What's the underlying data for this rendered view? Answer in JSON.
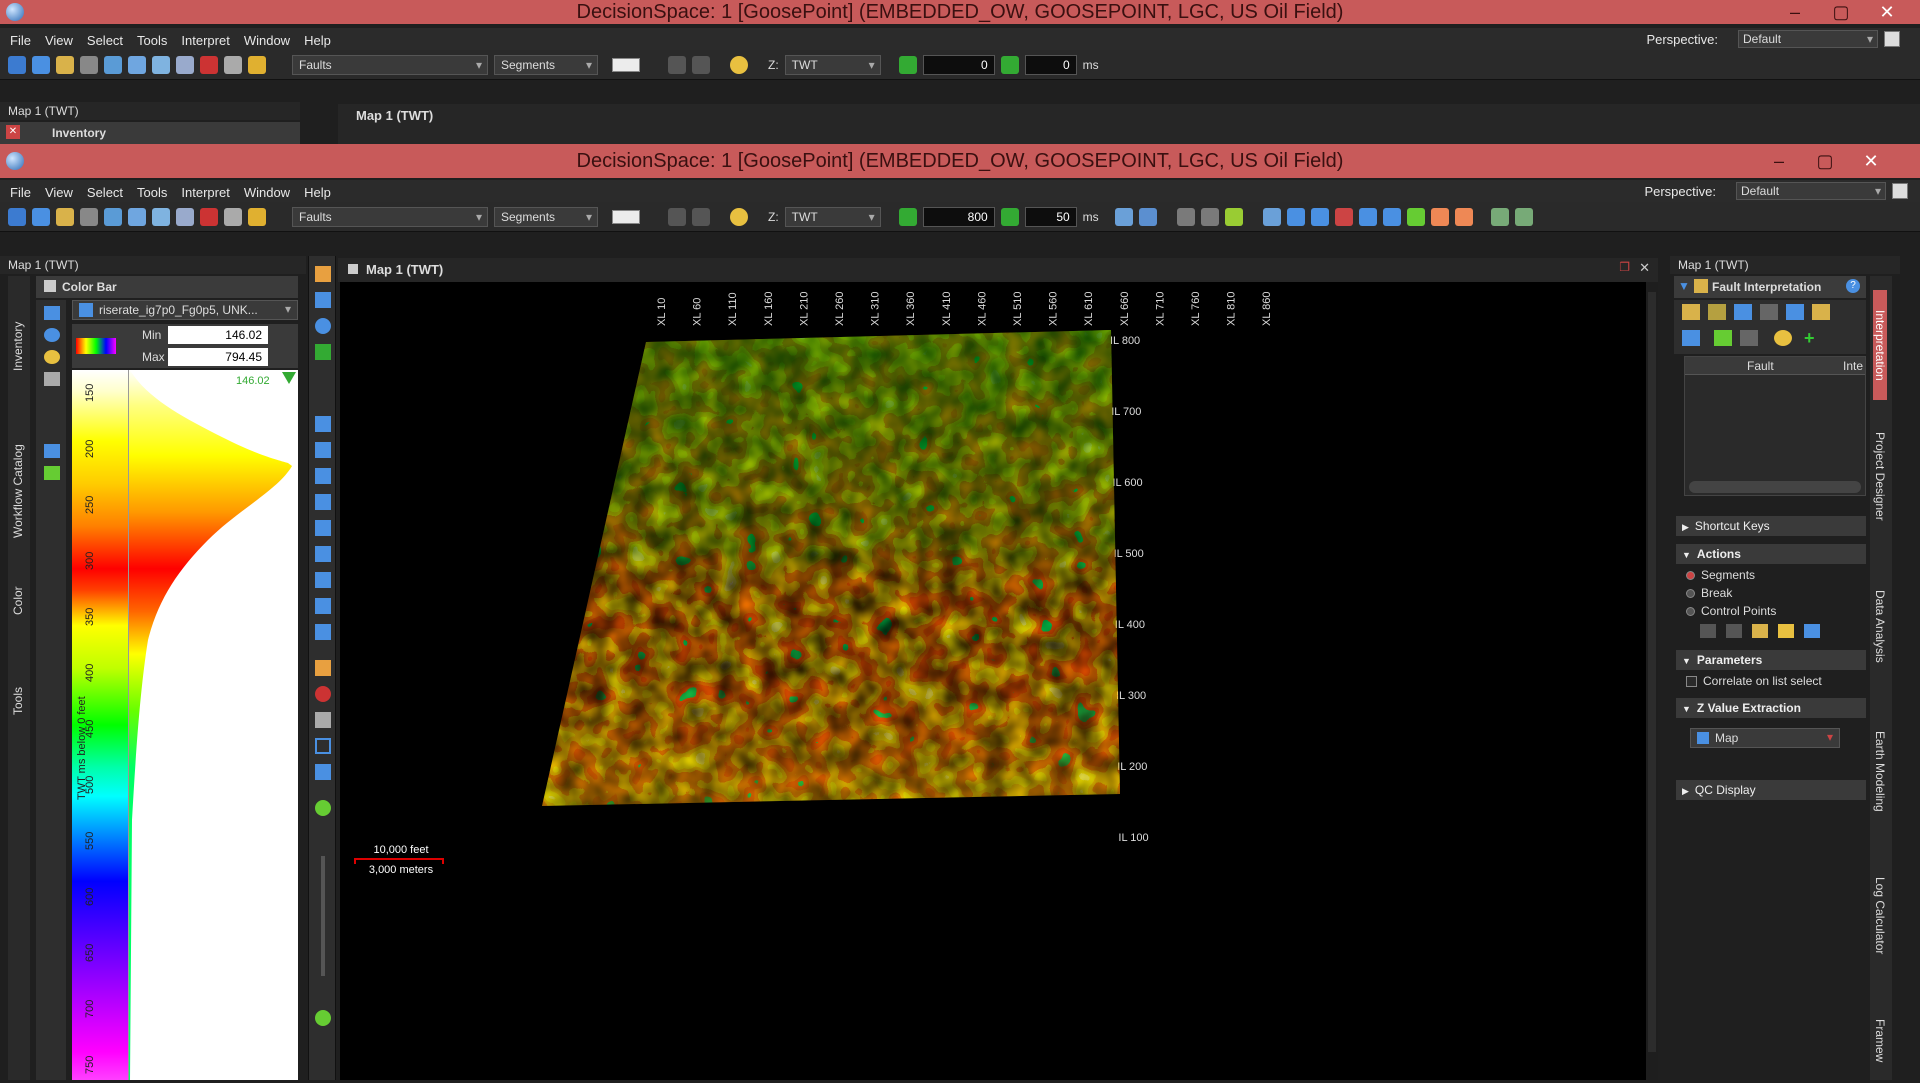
{
  "window_back": {
    "title": "DecisionSpace: 1 [GoosePoint] (EMBEDDED_OW, GOOSEPOINT, LGC, US Oil Field)",
    "menu": [
      "File",
      "View",
      "Select",
      "Tools",
      "Interpret",
      "Window",
      "Help"
    ],
    "perspective_label": "Perspective:",
    "perspective_value": "Default",
    "toolbar": {
      "fault_dd": "Faults",
      "segments_dd": "Segments",
      "z_label": "Z:",
      "z_domain": "TWT",
      "time_value": "0",
      "step_value": "0",
      "step_unit": "ms"
    },
    "left_panel_title": "Map 1 (TWT)",
    "inventory_tab": "Inventory",
    "view_tab": "Map 1 (TWT)"
  },
  "window_front": {
    "title": "DecisionSpace: 1 [GoosePoint] (EMBEDDED_OW, GOOSEPOINT, LGC, US Oil Field)",
    "menu": [
      "File",
      "View",
      "Select",
      "Tools",
      "Interpret",
      "Window",
      "Help"
    ],
    "perspective_label": "Perspective:",
    "perspective_value": "Default",
    "toolbar": {
      "fault_dd": "Faults",
      "segments_dd": "Segments",
      "z_label": "Z:",
      "z_domain": "TWT",
      "time_value": "800",
      "step_value": "50",
      "step_unit": "ms"
    }
  },
  "left_panel": {
    "header": "Map 1 (TWT)",
    "color_bar_title": "Color Bar",
    "attribute_dd": "riserate_ig7p0_Fg0p5, UNK...",
    "min_label": "Min",
    "min_value": "146.02",
    "max_label": "Max",
    "max_value": "794.45",
    "top_marker": "146.02",
    "axis_label": "TWT ms below 0 feet",
    "ticks": [
      "150",
      "200",
      "250",
      "300",
      "350",
      "400",
      "450",
      "500",
      "550",
      "600",
      "650",
      "700",
      "750"
    ],
    "side_tabs": [
      "Inventory",
      "Workflow Catalog",
      "Color",
      "Tools"
    ]
  },
  "map_view": {
    "tab_title": "Map 1 (TWT)",
    "xl_labels": [
      "XL 10",
      "XL 60",
      "XL 110",
      "XL 160",
      "XL 210",
      "XL 260",
      "XL 310",
      "XL 360",
      "XL 410",
      "XL 460",
      "XL 510",
      "XL 560",
      "XL 610",
      "XL 660",
      "XL 710",
      "XL 760",
      "XL 810",
      "XL 860"
    ],
    "il_labels": [
      "IL 800",
      "IL 700",
      "IL 600",
      "IL 500",
      "IL 400",
      "IL 300",
      "IL 200",
      "IL 100"
    ],
    "scale_feet": "10,000 feet",
    "scale_meters": "3,000 meters"
  },
  "right_panel": {
    "header": "Map 1 (TWT)",
    "title": "Fault Interpretation",
    "col_fault": "Fault",
    "col_inte": "Inte",
    "sections": {
      "shortcut": "Shortcut Keys",
      "actions": "Actions",
      "parameters": "Parameters",
      "zvalue": "Z Value Extraction",
      "qc": "QC Display"
    },
    "actions": [
      "Segments",
      "Break",
      "Control Points"
    ],
    "correlate": "Correlate on list select",
    "map_dd": "Map",
    "side_tabs": [
      "Interpretation",
      "Project Designer",
      "Data Analysis",
      "Earth Modeling",
      "Log Calculator",
      "Framew"
    ]
  },
  "colors": {
    "titlebar": "#c85a5a",
    "accent_red": "#d04040"
  }
}
